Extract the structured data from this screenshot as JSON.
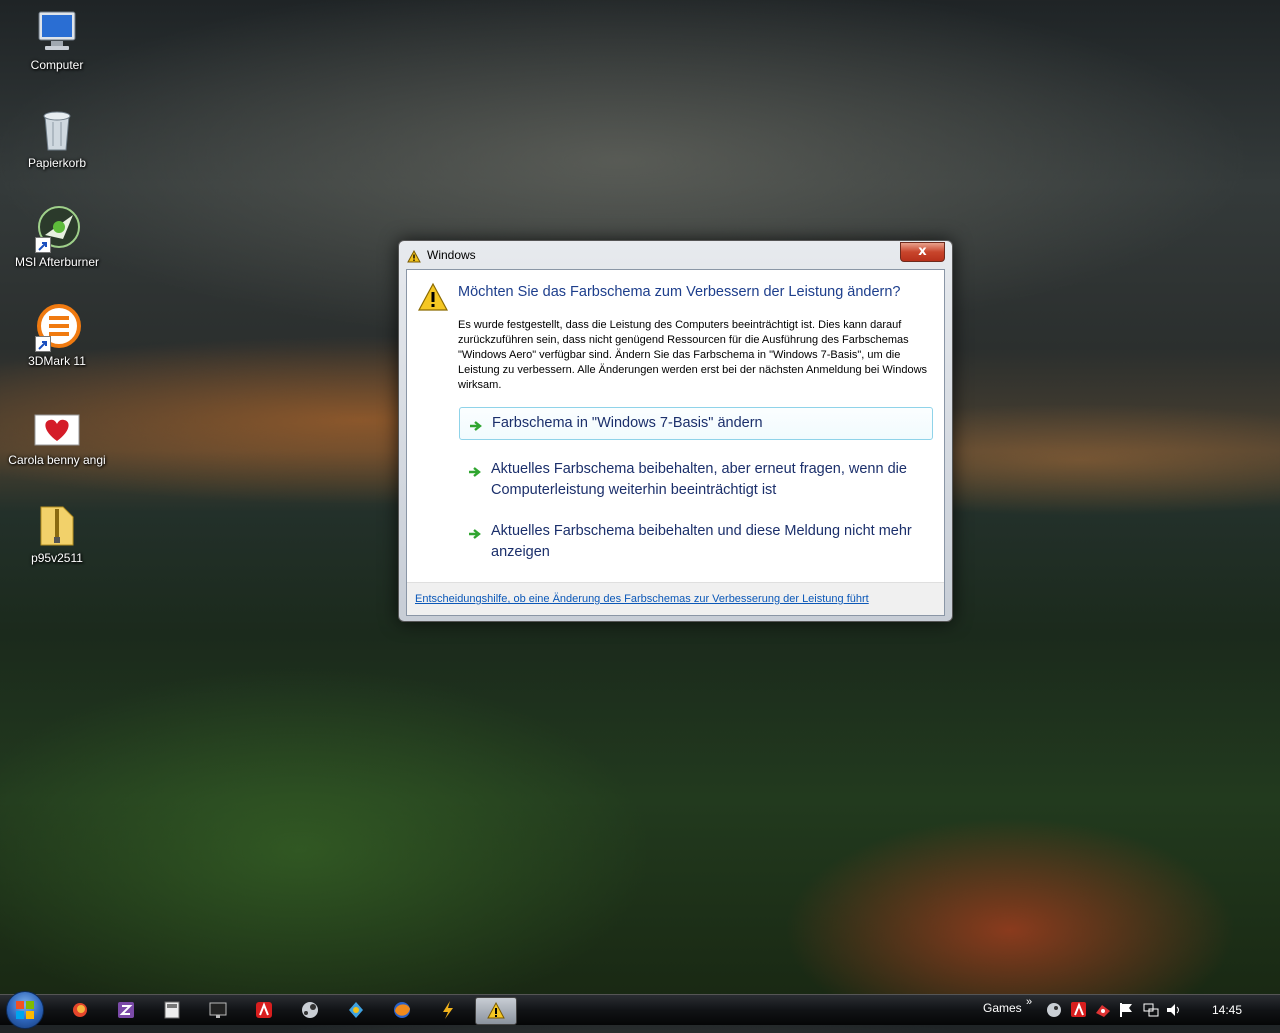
{
  "desktop": {
    "icons": [
      {
        "label": "Computer",
        "icon": "computer-icon"
      },
      {
        "label": "Papierkorb",
        "icon": "recycle-bin-icon"
      },
      {
        "label": "MSI Afterburner",
        "icon": "msi-afterburner-icon"
      },
      {
        "label": "3DMark 11",
        "icon": "3dmark-icon"
      },
      {
        "label": "Carola benny angi",
        "icon": "heart-image-icon"
      },
      {
        "label": "p95v2511",
        "icon": "zip-folder-icon"
      }
    ]
  },
  "dialog": {
    "title": "Windows",
    "headline": "Möchten Sie das Farbschema zum Verbessern der Leistung ändern?",
    "description": "Es wurde festgestellt, dass die Leistung des Computers beeinträchtigt ist. Dies kann darauf zurückzuführen sein, dass nicht genügend Ressourcen für die Ausführung des Farbschemas \"Windows Aero\" verfügbar sind. Ändern Sie das Farbschema in \"Windows 7-Basis\", um die Leistung zu verbessern. Alle Änderungen werden erst bei der nächsten Anmeldung bei Windows wirksam.",
    "close_label": "x",
    "options": [
      {
        "label": "Farbschema in \"Windows 7-Basis\" ändern"
      },
      {
        "label": "Aktuelles Farbschema beibehalten, aber erneut fragen, wenn die Computerleistung weiterhin beeinträchtigt ist"
      },
      {
        "label": "Aktuelles Farbschema beibehalten und diese Meldung nicht mehr anzeigen"
      }
    ],
    "help_link": "Entscheidungshilfe, ob eine Änderung des Farbschemas zur Verbesserung der Leistung führt"
  },
  "taskbar": {
    "pinned": [
      "firefox-icon-1",
      "z-icon",
      "calc-icon",
      "monitor-icon",
      "avira-icon",
      "steam-icon",
      "game-icon",
      "firefox-icon",
      "winamp-icon",
      "warning-icon"
    ],
    "toolbar_label": "Games",
    "chevron": "»",
    "clock": "14:45"
  },
  "colors": {
    "headline": "#1d3e8c",
    "link": "#0b58b8",
    "accent_green": "#2fa52f"
  }
}
